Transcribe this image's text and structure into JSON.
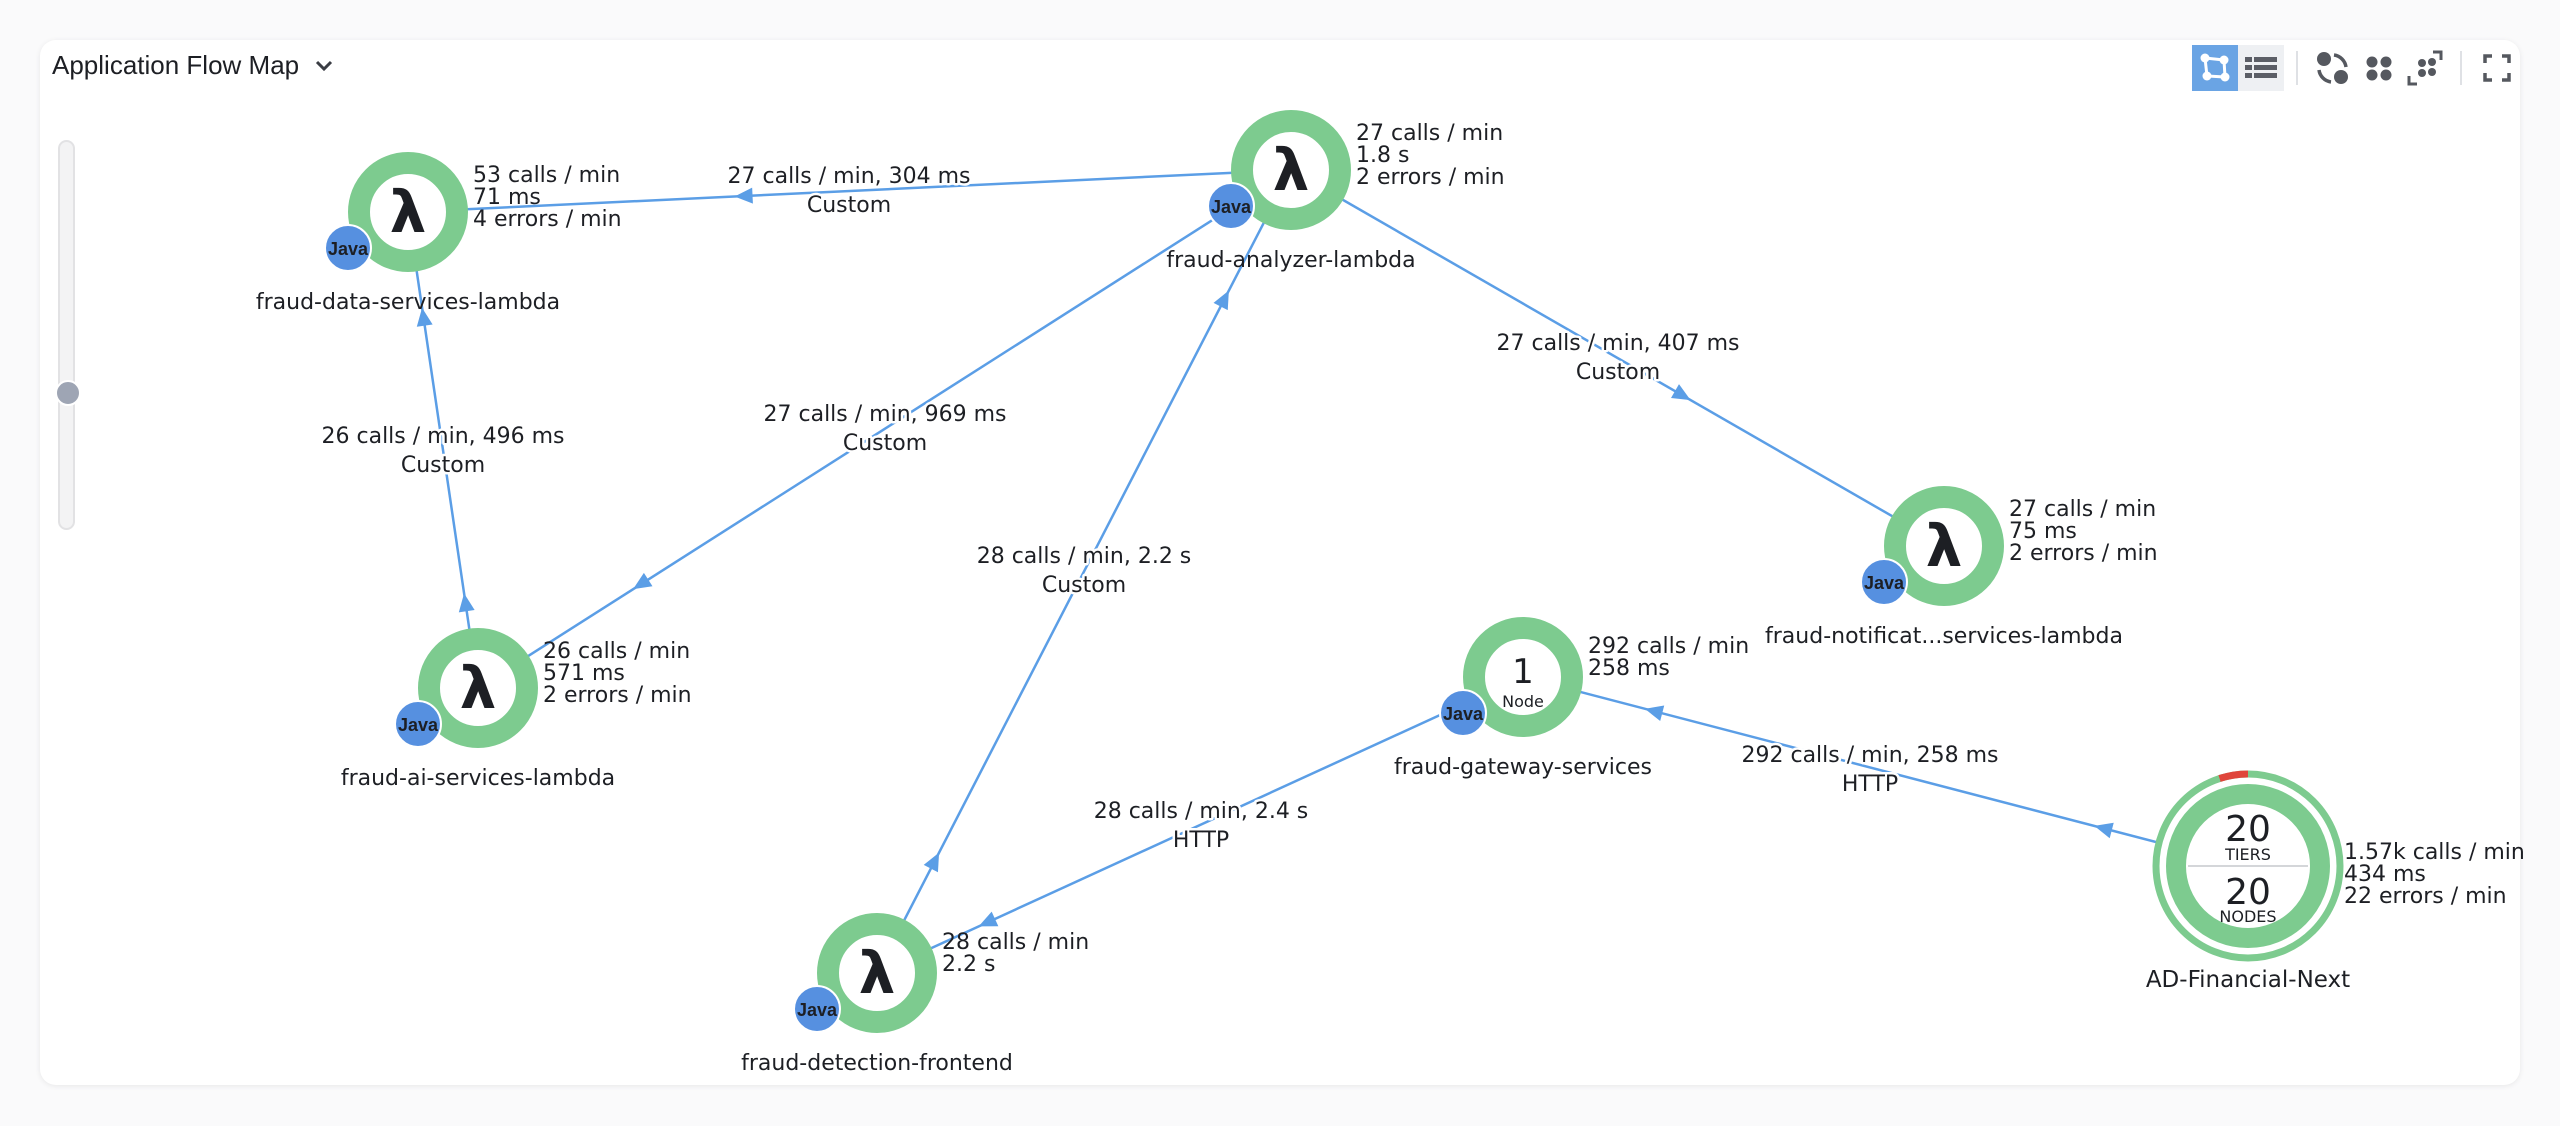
{
  "header": {
    "title": "Application Flow Map"
  },
  "toolbar": {
    "buttons": [
      {
        "name": "flow-map-view-button",
        "icon": "graph-icon",
        "active": true
      },
      {
        "name": "grid-view-button",
        "icon": "grid-list-icon",
        "active": false
      },
      {
        "name": "auto-arrange-button",
        "icon": "circular-arrange-icon",
        "active": false
      },
      {
        "name": "group-nodes-button",
        "icon": "cluster-icon",
        "active": false
      },
      {
        "name": "expand-group-button",
        "icon": "expand-nodes-icon",
        "active": false
      },
      {
        "name": "fullscreen-button",
        "icon": "fullscreen-icon",
        "active": false
      }
    ]
  },
  "zoom_slider": {
    "level_fraction_from_bottom": 0.38
  },
  "colors": {
    "healthy": "#7dcb8f",
    "error": "#e0453b",
    "edge": "#5b9ee6",
    "java_badge": "#5690e0",
    "lambda_glyph": "#6e6e6e"
  },
  "nodes": [
    {
      "id": "data",
      "name": "fraud-data-services-lambda",
      "type": "lambda",
      "badge": "Java",
      "stats": [
        "53 calls / min",
        "71 ms",
        "4 errors / min"
      ]
    },
    {
      "id": "analyzer",
      "name": "fraud-analyzer-lambda",
      "type": "lambda",
      "badge": "Java",
      "stats": [
        "27 calls / min",
        "1.8 s",
        "2 errors / min"
      ]
    },
    {
      "id": "notif",
      "name": "fraud-notificat...services-lambda",
      "type": "lambda",
      "badge": "Java",
      "stats": [
        "27 calls / min",
        "75 ms",
        "2 errors / min"
      ]
    },
    {
      "id": "ai",
      "name": "fraud-ai-services-lambda",
      "type": "lambda",
      "badge": "Java",
      "stats": [
        "26 calls / min",
        "571 ms",
        "2 errors / min"
      ]
    },
    {
      "id": "frontend",
      "name": "fraud-detection-frontend",
      "type": "lambda",
      "badge": "Java",
      "stats": [
        "28 calls / min",
        "2.2 s"
      ]
    },
    {
      "id": "gateway",
      "name": "fraud-gateway-services",
      "type": "node",
      "badge": "Java",
      "count": "1",
      "count_label": "Node",
      "stats": [
        "292 calls / min",
        "258 ms"
      ]
    },
    {
      "id": "app",
      "name": "AD-Financial-Next",
      "type": "application",
      "tiers": "20",
      "tiers_label": "TIERS",
      "nodes": "20",
      "nodes_label": "NODES",
      "error_fraction": 0.05,
      "stats": [
        "1.57k calls / min",
        "434 ms",
        "22 errors / min"
      ]
    }
  ],
  "edges": [
    {
      "from": "analyzer",
      "to": "data",
      "label": "27 calls / min, 304 ms",
      "type": "Custom"
    },
    {
      "from": "analyzer",
      "to": "notif",
      "label": "27 calls / min, 407 ms",
      "type": "Custom"
    },
    {
      "from": "ai",
      "to": "data",
      "label": "26 calls / min, 496 ms",
      "type": "Custom"
    },
    {
      "from": "analyzer",
      "to": "ai",
      "label": "27 calls / min, 969 ms",
      "type": "Custom"
    },
    {
      "from": "frontend",
      "to": "analyzer",
      "label": "28 calls / min, 2.2 s",
      "type": "Custom"
    },
    {
      "from": "gateway",
      "to": "frontend",
      "label": "28 calls / min, 2.4 s",
      "type": "HTTP"
    },
    {
      "from": "app",
      "to": "gateway",
      "label": "292 calls / min, 258 ms",
      "type": "HTTP"
    }
  ]
}
